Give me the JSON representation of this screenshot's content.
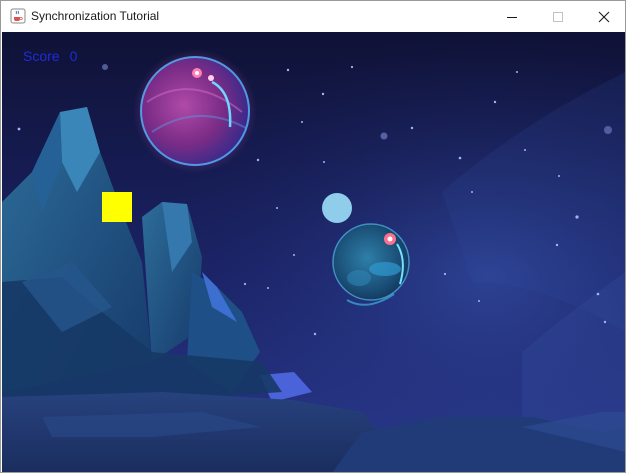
{
  "window": {
    "title": "Synchronization Tutorial",
    "controls": {
      "minimize": "minimize-icon",
      "maximize": "maximize-icon",
      "close": "close-icon"
    }
  },
  "game": {
    "score_label": "Score",
    "score_value": "0",
    "colors": {
      "sky": "#1a1a4a",
      "score_text": "#1f2bd9",
      "player": "#ffff00",
      "ball": "#8fcdea"
    }
  }
}
